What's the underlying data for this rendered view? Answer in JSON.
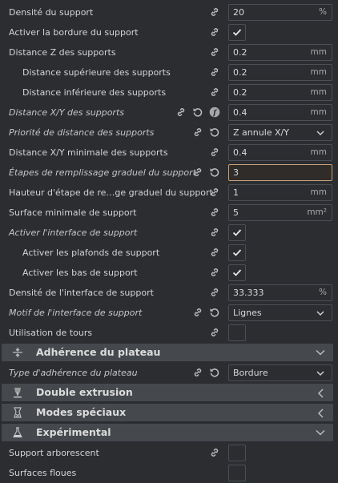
{
  "settings": [
    {
      "label": "Densité du support",
      "value": "20",
      "unit": "%"
    },
    {
      "label": "Activer la bordure du support"
    },
    {
      "label": "Distance Z des supports",
      "value": "0.2",
      "unit": "mm"
    },
    {
      "label": "Distance supérieure des supports",
      "value": "0.2",
      "unit": "mm"
    },
    {
      "label": "Distance inférieure des supports",
      "value": "0.2",
      "unit": "mm"
    },
    {
      "label": "Distance X/Y des supports",
      "value": "0.4",
      "unit": "mm"
    },
    {
      "label": "Priorité de distance des supports",
      "value": "Z annule X/Y"
    },
    {
      "label": "Distance X/Y minimale des supports",
      "value": "0.4",
      "unit": "mm"
    },
    {
      "label": "Étapes de remplissage graduel du support",
      "value": "3"
    },
    {
      "label": "Hauteur d'étape de re…ge graduel du support",
      "value": "1",
      "unit": "mm"
    },
    {
      "label": "Surface minimale de support",
      "value": "5",
      "unit": "mm²"
    },
    {
      "label": "Activer l'interface de support"
    },
    {
      "label": "Activer les plafonds de support"
    },
    {
      "label": "Activer les bas de support"
    },
    {
      "label": "Densité de l'interface de support",
      "value": "33.333",
      "unit": "%"
    },
    {
      "label": "Motif de l'interface de support",
      "value": "Lignes"
    },
    {
      "label": "Utilisation de tours"
    },
    {
      "label": "Type d'adhérence du plateau",
      "value": "Bordure"
    },
    {
      "label": "Support arborescent"
    },
    {
      "label": "Surfaces floues"
    }
  ],
  "sections": [
    {
      "title": "Adhérence du plateau",
      "icon": "plate-adhesion-icon",
      "state": "expanded"
    },
    {
      "title": "Double extrusion",
      "icon": "dual-extrusion-icon",
      "state": "collapsed"
    },
    {
      "title": "Modes spéciaux",
      "icon": "special-modes-icon",
      "state": "collapsed"
    },
    {
      "title": "Expérimental",
      "icon": "experimental-flask-icon",
      "state": "expanded"
    }
  ],
  "colors": {
    "background": "#2b2d31",
    "section": "#45484d",
    "active_border": "#c9a37a"
  }
}
